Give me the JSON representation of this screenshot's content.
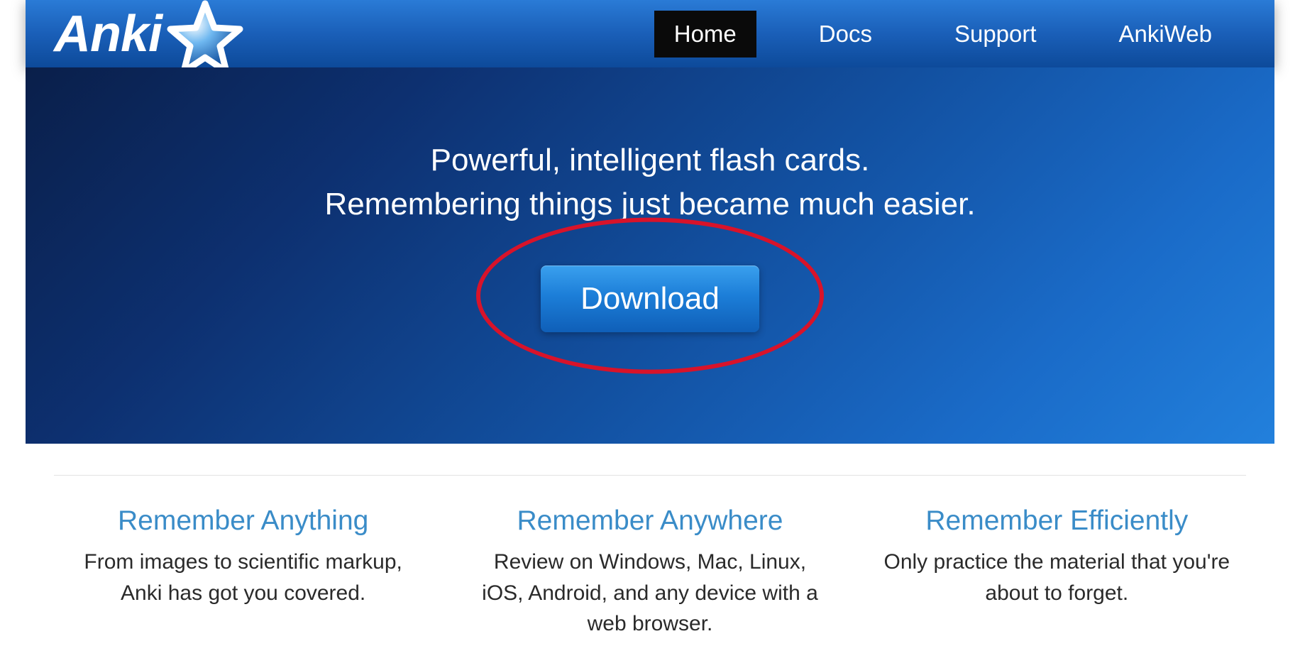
{
  "logo": {
    "text": "Anki"
  },
  "nav": {
    "items": [
      {
        "label": "Home",
        "active": true
      },
      {
        "label": "Docs",
        "active": false
      },
      {
        "label": "Support",
        "active": false
      },
      {
        "label": "AnkiWeb",
        "active": false
      }
    ]
  },
  "hero": {
    "tagline_line1": "Powerful, intelligent flash cards.",
    "tagline_line2": "Remembering things just became much easier.",
    "download_label": "Download"
  },
  "features": [
    {
      "title": "Remember Anything",
      "desc": "From images to scientific markup, Anki has got you covered."
    },
    {
      "title": "Remember Anywhere",
      "desc": "Review on Windows, Mac, Linux, iOS, Android, and any device with a web browser."
    },
    {
      "title": "Remember Efficiently",
      "desc": "Only practice the material that you're about to forget."
    }
  ],
  "annotation": {
    "highlight": "download-button"
  }
}
